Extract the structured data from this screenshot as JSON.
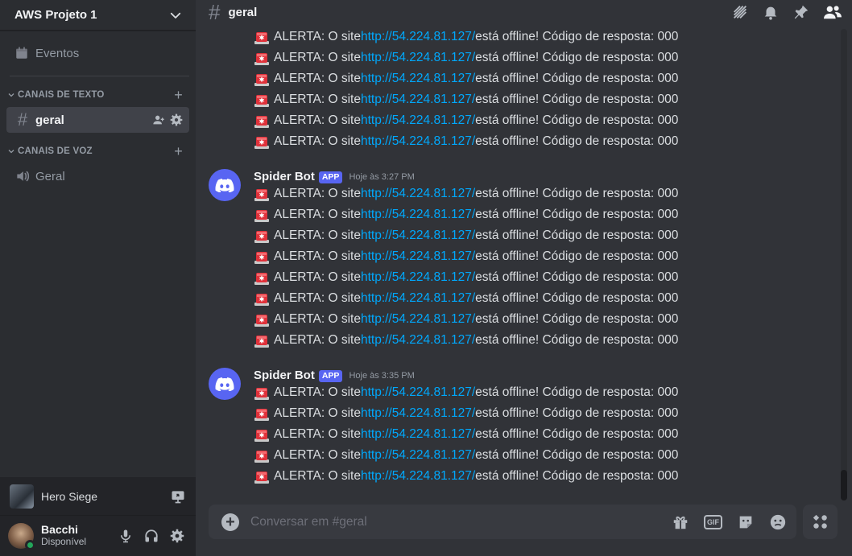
{
  "server": {
    "name": "AWS Projeto 1"
  },
  "sidebar": {
    "events_label": "Eventos",
    "text_category": "CANAIS DE TEXTO",
    "voice_category": "CANAIS DE VOZ",
    "text_channels": [
      {
        "name": "geral",
        "active": true
      }
    ],
    "voice_channels": [
      {
        "name": "Geral"
      }
    ]
  },
  "activity": {
    "name": "Hero Siege"
  },
  "user": {
    "name": "Bacchi",
    "status": "Disponível",
    "status_color": "#23a55a"
  },
  "channel_header": {
    "name": "geral"
  },
  "alert": {
    "prefix": "ALERTA: O site ",
    "url": "http://54.224.81.127/",
    "suffix": " está offline! Código de resposta: 000"
  },
  "messages": {
    "continuation_count": 6,
    "groups": [
      {
        "author": "Spider Bot",
        "badge": "APP",
        "timestamp": "Hoje às 3:27 PM",
        "line_count": 8
      },
      {
        "author": "Spider Bot",
        "badge": "APP",
        "timestamp": "Hoje às 3:35 PM",
        "line_count": 5
      }
    ]
  },
  "composer": {
    "placeholder": "Conversar em #geral"
  },
  "colors": {
    "link": "#00a8fc",
    "brand": "#5865f2",
    "online": "#23a55a"
  }
}
